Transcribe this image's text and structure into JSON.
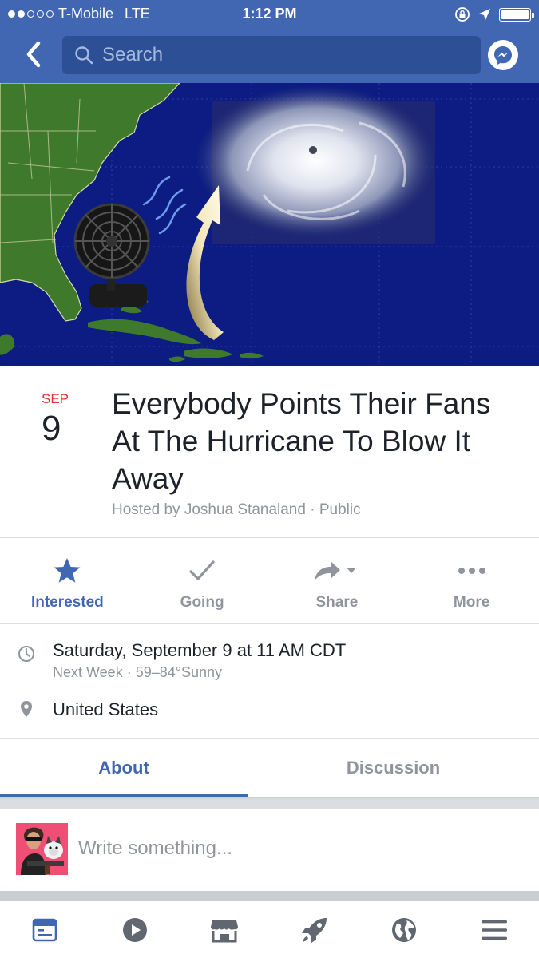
{
  "status_bar": {
    "carrier": "T-Mobile",
    "network": "LTE",
    "time": "1:12 PM",
    "signal_bars": 2,
    "signal_total": 5
  },
  "header": {
    "search_placeholder": "Search",
    "back_icon": "chevron-left-icon",
    "messenger_icon": "messenger-icon"
  },
  "event": {
    "month": "SEP",
    "day": "9",
    "title": "Everybody Points Their Fans At The Hurricane To Blow It Away",
    "host_line": "Hosted by Joshua Stanaland · Public"
  },
  "actions": [
    {
      "label": "Interested",
      "icon": "star-icon",
      "active": true
    },
    {
      "label": "Going",
      "icon": "check-icon",
      "active": false
    },
    {
      "label": "Share",
      "icon": "share-icon",
      "active": false
    },
    {
      "label": "More",
      "icon": "more-icon",
      "active": false
    }
  ],
  "details": {
    "datetime": "Saturday, September 9 at 11 AM CDT",
    "datetime_sub": "Next Week · 59–84°Sunny",
    "location": "United States"
  },
  "tabs": [
    {
      "label": "About",
      "active": true
    },
    {
      "label": "Discussion",
      "active": false
    }
  ],
  "composer": {
    "placeholder": "Write something..."
  },
  "bottom_nav": [
    "news-feed-icon",
    "video-icon",
    "marketplace-icon",
    "rocket-icon",
    "globe-icon",
    "menu-icon"
  ],
  "colors": {
    "brand": "#4267b2",
    "date_red": "#e02f2f",
    "muted": "#90949c"
  }
}
